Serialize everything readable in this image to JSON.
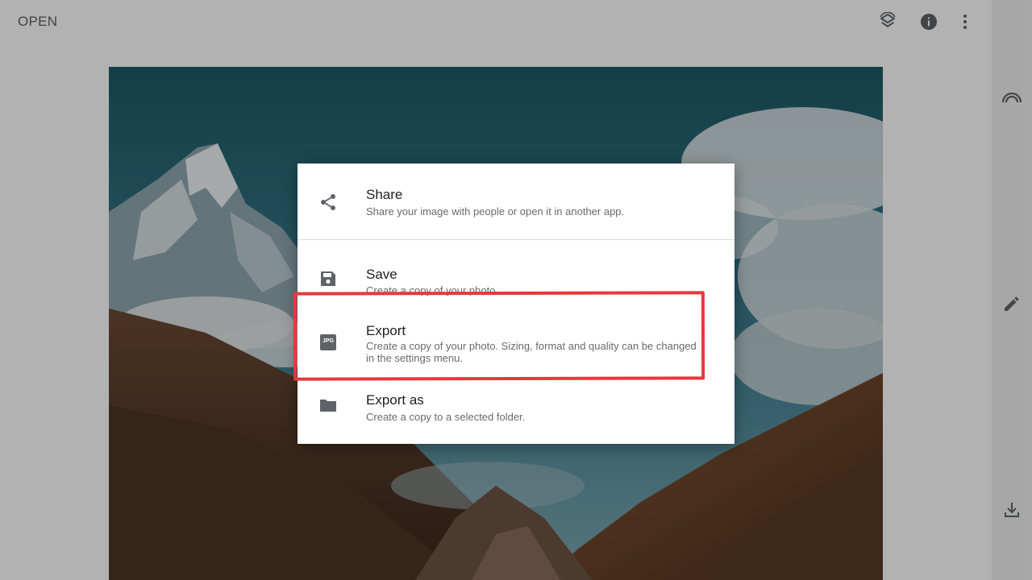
{
  "topbar": {
    "open_label": "OPEN",
    "icons": [
      "layers-stack-icon",
      "info-icon",
      "more-vert-icon"
    ]
  },
  "sidebar": {
    "icons": [
      "looks-icon",
      "edit-pencil-icon",
      "download-icon"
    ]
  },
  "dialog": {
    "items": [
      {
        "title": "Share",
        "description": "Share your image with people or open it in another app.",
        "icon": "share-icon"
      },
      {
        "title": "Save",
        "description": "Create a copy of your photo.",
        "icon": "save-icon"
      },
      {
        "title": "Export",
        "description": "Create a copy of your photo. Sizing, format and quality can be changed in the settings menu.",
        "icon": "jpg-file-icon",
        "icon_text": "JPG"
      },
      {
        "title": "Export as",
        "description": "Create a copy to a selected folder.",
        "icon": "folder-icon"
      }
    ]
  },
  "colors": {
    "highlight": "#e8383d",
    "sky_top": "#1c5a66",
    "icon_gray": "#5f6368"
  }
}
